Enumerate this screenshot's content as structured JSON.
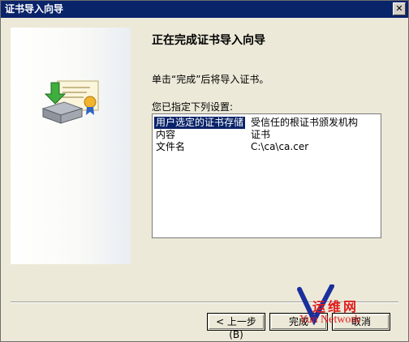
{
  "window": {
    "title": "证书导入向导",
    "close_glyph": "✕"
  },
  "wizard": {
    "heading": "正在完成证书导入向导",
    "description": "单击“完成”后将导入证书。",
    "settings_label": "您已指定下列设置:",
    "settings": [
      {
        "key": "用户选定的证书存储",
        "value": "受信任的根证书颁发机构",
        "selected": true
      },
      {
        "key": "内容",
        "value": "证书",
        "selected": false
      },
      {
        "key": "文件名",
        "value": "C:\\ca\\ca.cer",
        "selected": false
      }
    ]
  },
  "buttons": {
    "back": "< 上一步(B)",
    "finish": "完成",
    "cancel": "取消"
  },
  "watermark": {
    "chinese": "运维网",
    "english": "Yun Network"
  },
  "colors": {
    "titlebar": "#0a246a",
    "dialog_bg": "#ece9d8",
    "selection": "#0a246a",
    "watermark": "#e21b1b"
  },
  "icons": [
    "certificate-import-icon",
    "close-icon",
    "watermark-logo"
  ]
}
